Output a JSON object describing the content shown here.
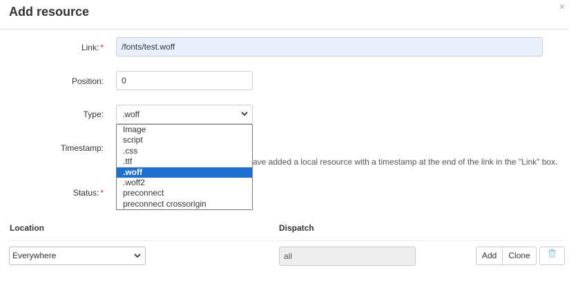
{
  "dialog": {
    "title": "Add resource",
    "close_glyph": "×"
  },
  "form": {
    "link_label": "Link:",
    "link_value": "/fonts/test.woff",
    "position_label": "Position:",
    "position_value": "0",
    "type_label": "Type:",
    "type_value": ".woff",
    "timestamp_label": "Timestamp:",
    "timestamp_help_visible": "ave added a local resource with a timestamp at the end of the link in the \"Link\" box.",
    "status_label": "Status:",
    "required_mark": "*"
  },
  "type_options": [
    {
      "label": "Image",
      "selected": false
    },
    {
      "label": "script",
      "selected": false
    },
    {
      "label": ".css",
      "selected": false
    },
    {
      "label": ".ttf",
      "selected": false
    },
    {
      "label": ".woff",
      "selected": true
    },
    {
      "label": ".woff2",
      "selected": false
    },
    {
      "label": "preconnect",
      "selected": false
    },
    {
      "label": "preconnect crossorigin",
      "selected": false
    }
  ],
  "rules": {
    "location_header": "Location",
    "dispatch_header": "Dispatch",
    "location_value": "Everywhere",
    "dispatch_value": "all",
    "add_label": "Add",
    "clone_label": "Clone",
    "delete_icon": "trash-icon"
  },
  "colors": {
    "selected_option_bg": "#1f6fd1",
    "autofill_bg": "#e8f0fe",
    "required": "#e7272d",
    "trash_icon": "#9cc6e8"
  }
}
